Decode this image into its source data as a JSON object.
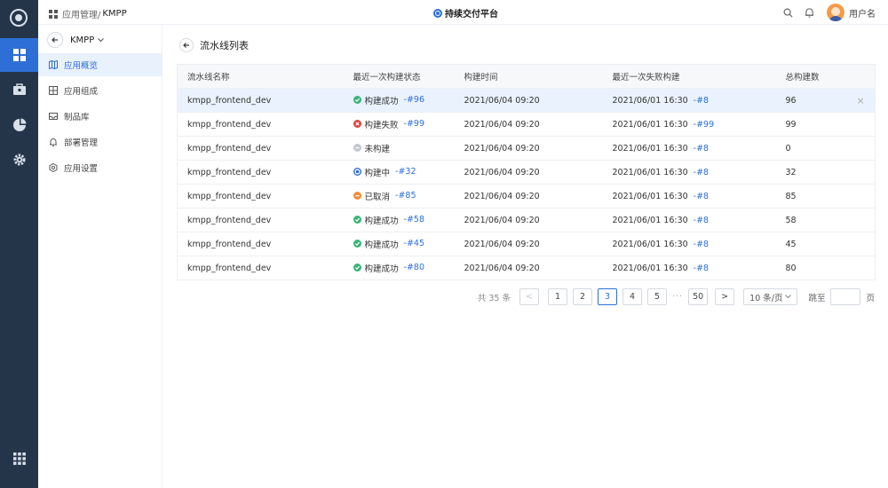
{
  "colors": {
    "rail": "#253549",
    "accent": "#2d6fd6",
    "success": "#3bb37a",
    "fail": "#e0403c",
    "none": "#c4c8ce",
    "cancel": "#f28d3a"
  },
  "header": {
    "breadcrumb_parent": "应用管理/",
    "breadcrumb_current": "KMPP",
    "brand": "持续交付平台",
    "user_name": "用户名"
  },
  "sidebar": {
    "project": "KMPP",
    "items": [
      {
        "label": "应用概览",
        "icon": "map-icon",
        "active": true
      },
      {
        "label": "应用组成",
        "icon": "grid-icon",
        "active": false
      },
      {
        "label": "制品库",
        "icon": "inbox-icon",
        "active": false
      },
      {
        "label": "部署管理",
        "icon": "bell-icon",
        "active": false
      },
      {
        "label": "应用设置",
        "icon": "settings-icon",
        "active": false
      }
    ]
  },
  "page": {
    "title": "流水线列表"
  },
  "table": {
    "columns": [
      "流水线名称",
      "最近一次构建状态",
      "构建时间",
      "最近一次失败构建",
      "总构建数"
    ],
    "rows": [
      {
        "name": "kmpp_frontend_dev",
        "status": "构建成功",
        "status_type": "success",
        "build_no": "-#96",
        "build_time": "2021/06/04 09:20",
        "fail_time": "2021/06/01 16:30",
        "fail_no": "-#8",
        "total": "96",
        "close": "×"
      },
      {
        "name": "kmpp_frontend_dev",
        "status": "构建失败",
        "status_type": "fail",
        "build_no": "-#99",
        "build_time": "2021/06/04 09:20",
        "fail_time": "2021/06/01 16:30",
        "fail_no": "-#99",
        "total": "99",
        "close": ""
      },
      {
        "name": "kmpp_frontend_dev",
        "status": "未构建",
        "status_type": "none",
        "build_no": "",
        "build_time": "2021/06/04 09:20",
        "fail_time": "2021/06/01 16:30",
        "fail_no": "-#8",
        "total": "0",
        "close": ""
      },
      {
        "name": "kmpp_frontend_dev",
        "status": "构建中",
        "status_type": "running",
        "build_no": "-#32",
        "build_time": "2021/06/04 09:20",
        "fail_time": "2021/06/01 16:30",
        "fail_no": "-#8",
        "total": "32",
        "close": ""
      },
      {
        "name": "kmpp_frontend_dev",
        "status": "已取消",
        "status_type": "cancel",
        "build_no": "-#85",
        "build_time": "2021/06/04 09:20",
        "fail_time": "2021/06/01 16:30",
        "fail_no": "-#8",
        "total": "85",
        "close": ""
      },
      {
        "name": "kmpp_frontend_dev",
        "status": "构建成功",
        "status_type": "success",
        "build_no": "-#58",
        "build_time": "2021/06/04 09:20",
        "fail_time": "2021/06/01 16:30",
        "fail_no": "-#8",
        "total": "58",
        "close": ""
      },
      {
        "name": "kmpp_frontend_dev",
        "status": "构建成功",
        "status_type": "success",
        "build_no": "-#45",
        "build_time": "2021/06/04 09:20",
        "fail_time": "2021/06/01 16:30",
        "fail_no": "-#8",
        "total": "45",
        "close": ""
      },
      {
        "name": "kmpp_frontend_dev",
        "status": "构建成功",
        "status_type": "success",
        "build_no": "-#80",
        "build_time": "2021/06/04 09:20",
        "fail_time": "2021/06/01 16:30",
        "fail_no": "-#8",
        "total": "80",
        "close": ""
      }
    ]
  },
  "pagination": {
    "total_text": "共 35 条",
    "prev": "<",
    "pages": [
      "1",
      "2",
      "3",
      "4",
      "5"
    ],
    "current": "3",
    "ellipsis": "···",
    "last": "50",
    "next": ">",
    "page_size": "10 条/页",
    "jump_label": "跳至",
    "jump_value": "",
    "page_suffix": "页"
  }
}
